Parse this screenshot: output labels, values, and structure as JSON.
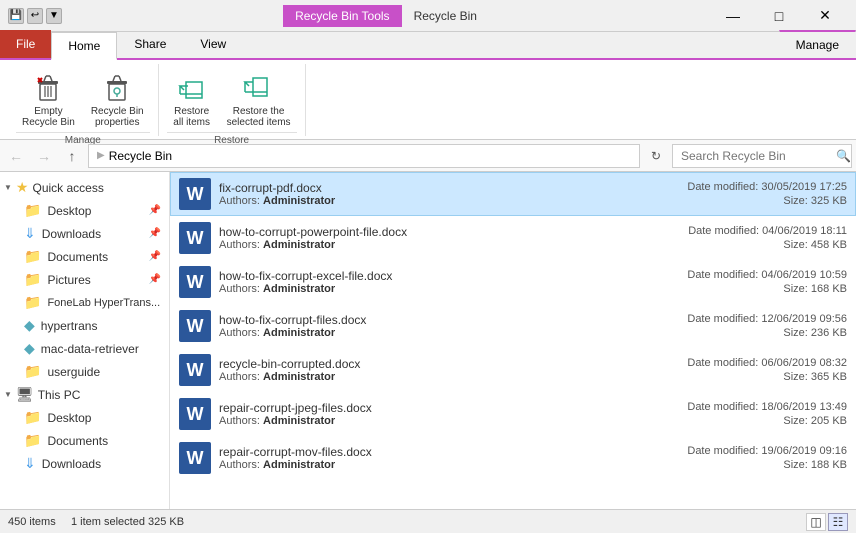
{
  "titlebar": {
    "app_title": "Recycle Bin",
    "tools_tab": "Recycle Bin Tools",
    "minimize": "—",
    "maximize": "□",
    "close": "✕"
  },
  "ribbon_tabs": {
    "file": "File",
    "home": "Home",
    "share": "Share",
    "view": "View",
    "manage": "Manage"
  },
  "ribbon": {
    "empty_label": "Empty\nRecycle Bin",
    "properties_label": "Recycle Bin\nproperties",
    "restore_all_label": "Restore\nall items",
    "restore_selected_label": "Restore the\nselected items",
    "manage_group": "Manage",
    "restore_group": "Restore"
  },
  "addressbar": {
    "breadcrumb": "Recycle Bin",
    "search_placeholder": "Search Recycle Bin"
  },
  "sidebar": {
    "quick_access": "Quick access",
    "desktop": "Desktop",
    "downloads": "Downloads",
    "documents": "Documents",
    "pictures": "Pictures",
    "fonelab": "FoneLab HyperTrans...",
    "hypertrans": "hypertrans",
    "mac_retriever": "mac-data-retriever",
    "userguide": "userguide",
    "this_pc": "This PC",
    "pc_desktop": "Desktop",
    "pc_documents": "Documents",
    "pc_downloads": "Downloads"
  },
  "files": [
    {
      "name": "fix-corrupt-pdf.docx",
      "author": "Administrator",
      "date": "Date modified: 30/05/2019 17:25",
      "size": "Size: 325 KB",
      "selected": true
    },
    {
      "name": "how-to-corrupt-powerpoint-file.docx",
      "author": "Administrator",
      "date": "Date modified: 04/06/2019 18:11",
      "size": "Size: 458 KB",
      "selected": false
    },
    {
      "name": "how-to-fix-corrupt-excel-file.docx",
      "author": "Administrator",
      "date": "Date modified: 04/06/2019 10:59",
      "size": "Size: 168 KB",
      "selected": false
    },
    {
      "name": "how-to-fix-corrupt-files.docx",
      "author": "Administrator",
      "date": "Date modified: 12/06/2019 09:56",
      "size": "Size: 236 KB",
      "selected": false
    },
    {
      "name": "recycle-bin-corrupted.docx",
      "author": "Administrator",
      "date": "Date modified: 06/06/2019 08:32",
      "size": "Size: 365 KB",
      "selected": false
    },
    {
      "name": "repair-corrupt-jpeg-files.docx",
      "author": "Administrator",
      "date": "Date modified: 18/06/2019 13:49",
      "size": "Size: 205 KB",
      "selected": false
    },
    {
      "name": "repair-corrupt-mov-files.docx",
      "author": "Administrator",
      "date": "Date modified: 19/06/2019 09:16",
      "size": "Size: 188 KB",
      "selected": false
    }
  ],
  "statusbar": {
    "count": "450 items",
    "selected": "1 item selected  325 KB"
  }
}
